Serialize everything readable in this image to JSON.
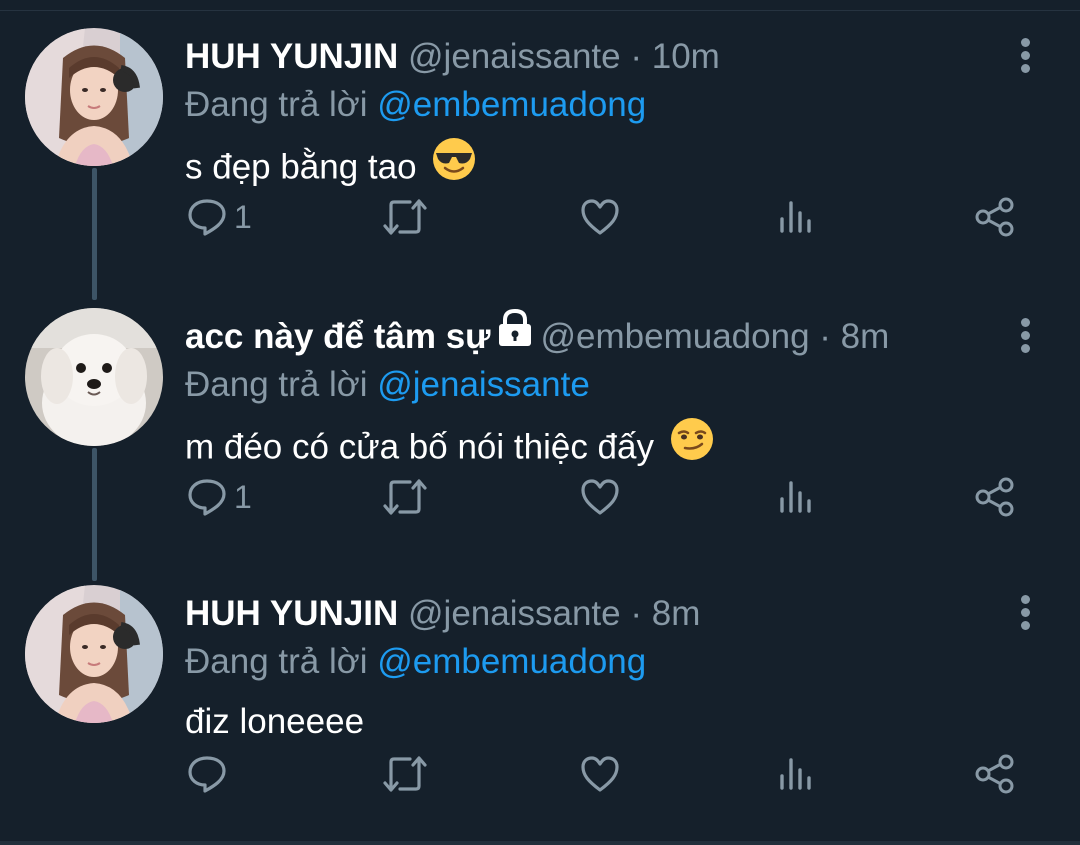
{
  "tweets": [
    {
      "name": "HUH YUNJIN",
      "handle": "@jenaissante",
      "dot": "·",
      "time": "10m",
      "reply_prefix": "Đang trả lời",
      "reply_to": "@embemuadong",
      "text": "s đẹp bằng tao",
      "emoji": "smiling-face-with-sunglasses",
      "avatar": "girl-selfie",
      "protected": false,
      "reply_count": "1"
    },
    {
      "name": "acc này để tâm sự",
      "handle": "@embemuadong",
      "dot": "·",
      "time": "8m",
      "reply_prefix": "Đang trả lời",
      "reply_to": "@jenaissante",
      "text": "m đéo có cửa bố nói thiệc đấy",
      "emoji": "smirking-face",
      "avatar": "white-puppy",
      "protected": true,
      "reply_count": "1"
    },
    {
      "name": "HUH YUNJIN",
      "handle": "@jenaissante",
      "dot": "·",
      "time": "8m",
      "reply_prefix": "Đang trả lời",
      "reply_to": "@embemuadong",
      "text": "điz loneeee",
      "emoji": "",
      "avatar": "girl-selfie",
      "protected": false,
      "reply_count": ""
    }
  ],
  "colors": {
    "background": "#15202b",
    "text": "#ffffff",
    "secondary": "#8899a6",
    "link": "#1d9bf0",
    "thread_line": "#3d5466"
  },
  "icons": [
    "reply-icon",
    "retweet-icon",
    "like-icon",
    "analytics-icon",
    "share-icon",
    "more-icon",
    "lock-icon"
  ]
}
